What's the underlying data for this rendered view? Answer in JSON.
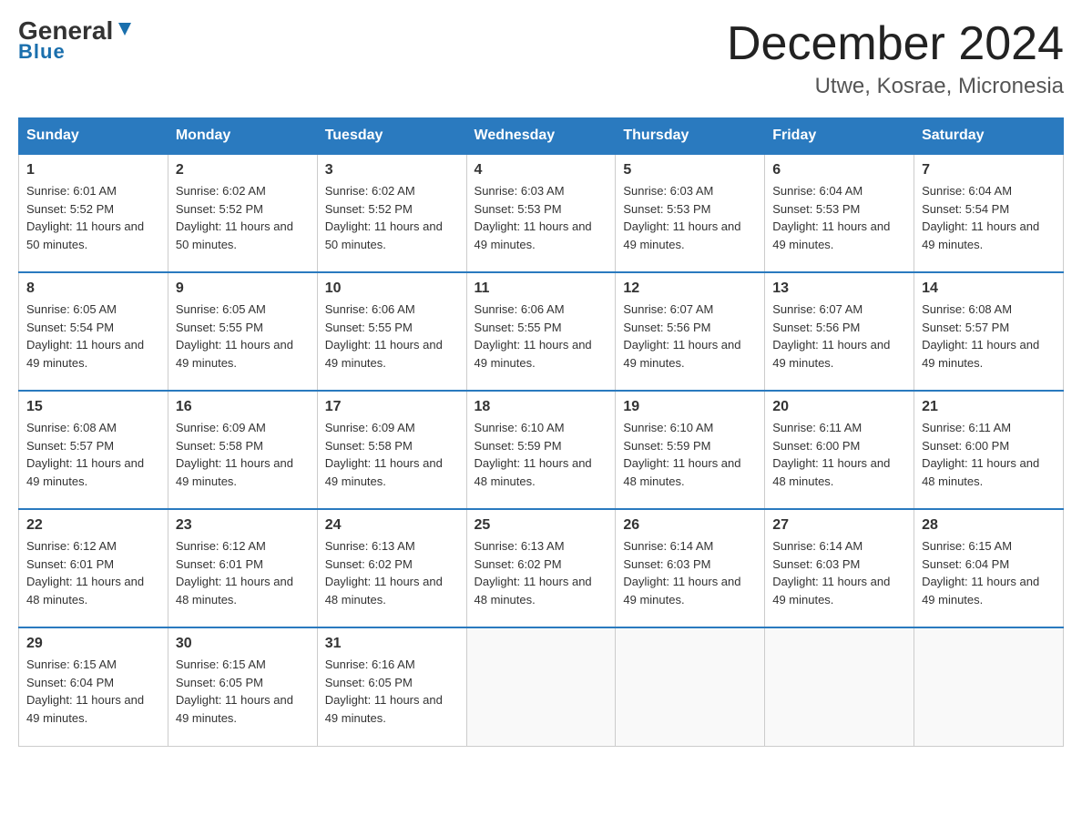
{
  "logo": {
    "general": "General",
    "blue": "Blue"
  },
  "title": "December 2024",
  "location": "Utwe, Kosrae, Micronesia",
  "headers": [
    "Sunday",
    "Monday",
    "Tuesday",
    "Wednesday",
    "Thursday",
    "Friday",
    "Saturday"
  ],
  "weeks": [
    [
      {
        "day": "1",
        "sunrise": "6:01 AM",
        "sunset": "5:52 PM",
        "daylight": "11 hours and 50 minutes."
      },
      {
        "day": "2",
        "sunrise": "6:02 AM",
        "sunset": "5:52 PM",
        "daylight": "11 hours and 50 minutes."
      },
      {
        "day": "3",
        "sunrise": "6:02 AM",
        "sunset": "5:52 PM",
        "daylight": "11 hours and 50 minutes."
      },
      {
        "day": "4",
        "sunrise": "6:03 AM",
        "sunset": "5:53 PM",
        "daylight": "11 hours and 49 minutes."
      },
      {
        "day": "5",
        "sunrise": "6:03 AM",
        "sunset": "5:53 PM",
        "daylight": "11 hours and 49 minutes."
      },
      {
        "day": "6",
        "sunrise": "6:04 AM",
        "sunset": "5:53 PM",
        "daylight": "11 hours and 49 minutes."
      },
      {
        "day": "7",
        "sunrise": "6:04 AM",
        "sunset": "5:54 PM",
        "daylight": "11 hours and 49 minutes."
      }
    ],
    [
      {
        "day": "8",
        "sunrise": "6:05 AM",
        "sunset": "5:54 PM",
        "daylight": "11 hours and 49 minutes."
      },
      {
        "day": "9",
        "sunrise": "6:05 AM",
        "sunset": "5:55 PM",
        "daylight": "11 hours and 49 minutes."
      },
      {
        "day": "10",
        "sunrise": "6:06 AM",
        "sunset": "5:55 PM",
        "daylight": "11 hours and 49 minutes."
      },
      {
        "day": "11",
        "sunrise": "6:06 AM",
        "sunset": "5:55 PM",
        "daylight": "11 hours and 49 minutes."
      },
      {
        "day": "12",
        "sunrise": "6:07 AM",
        "sunset": "5:56 PM",
        "daylight": "11 hours and 49 minutes."
      },
      {
        "day": "13",
        "sunrise": "6:07 AM",
        "sunset": "5:56 PM",
        "daylight": "11 hours and 49 minutes."
      },
      {
        "day": "14",
        "sunrise": "6:08 AM",
        "sunset": "5:57 PM",
        "daylight": "11 hours and 49 minutes."
      }
    ],
    [
      {
        "day": "15",
        "sunrise": "6:08 AM",
        "sunset": "5:57 PM",
        "daylight": "11 hours and 49 minutes."
      },
      {
        "day": "16",
        "sunrise": "6:09 AM",
        "sunset": "5:58 PM",
        "daylight": "11 hours and 49 minutes."
      },
      {
        "day": "17",
        "sunrise": "6:09 AM",
        "sunset": "5:58 PM",
        "daylight": "11 hours and 49 minutes."
      },
      {
        "day": "18",
        "sunrise": "6:10 AM",
        "sunset": "5:59 PM",
        "daylight": "11 hours and 48 minutes."
      },
      {
        "day": "19",
        "sunrise": "6:10 AM",
        "sunset": "5:59 PM",
        "daylight": "11 hours and 48 minutes."
      },
      {
        "day": "20",
        "sunrise": "6:11 AM",
        "sunset": "6:00 PM",
        "daylight": "11 hours and 48 minutes."
      },
      {
        "day": "21",
        "sunrise": "6:11 AM",
        "sunset": "6:00 PM",
        "daylight": "11 hours and 48 minutes."
      }
    ],
    [
      {
        "day": "22",
        "sunrise": "6:12 AM",
        "sunset": "6:01 PM",
        "daylight": "11 hours and 48 minutes."
      },
      {
        "day": "23",
        "sunrise": "6:12 AM",
        "sunset": "6:01 PM",
        "daylight": "11 hours and 48 minutes."
      },
      {
        "day": "24",
        "sunrise": "6:13 AM",
        "sunset": "6:02 PM",
        "daylight": "11 hours and 48 minutes."
      },
      {
        "day": "25",
        "sunrise": "6:13 AM",
        "sunset": "6:02 PM",
        "daylight": "11 hours and 48 minutes."
      },
      {
        "day": "26",
        "sunrise": "6:14 AM",
        "sunset": "6:03 PM",
        "daylight": "11 hours and 49 minutes."
      },
      {
        "day": "27",
        "sunrise": "6:14 AM",
        "sunset": "6:03 PM",
        "daylight": "11 hours and 49 minutes."
      },
      {
        "day": "28",
        "sunrise": "6:15 AM",
        "sunset": "6:04 PM",
        "daylight": "11 hours and 49 minutes."
      }
    ],
    [
      {
        "day": "29",
        "sunrise": "6:15 AM",
        "sunset": "6:04 PM",
        "daylight": "11 hours and 49 minutes."
      },
      {
        "day": "30",
        "sunrise": "6:15 AM",
        "sunset": "6:05 PM",
        "daylight": "11 hours and 49 minutes."
      },
      {
        "day": "31",
        "sunrise": "6:16 AM",
        "sunset": "6:05 PM",
        "daylight": "11 hours and 49 minutes."
      },
      null,
      null,
      null,
      null
    ]
  ],
  "labels": {
    "sunrise": "Sunrise:",
    "sunset": "Sunset:",
    "daylight": "Daylight:"
  }
}
